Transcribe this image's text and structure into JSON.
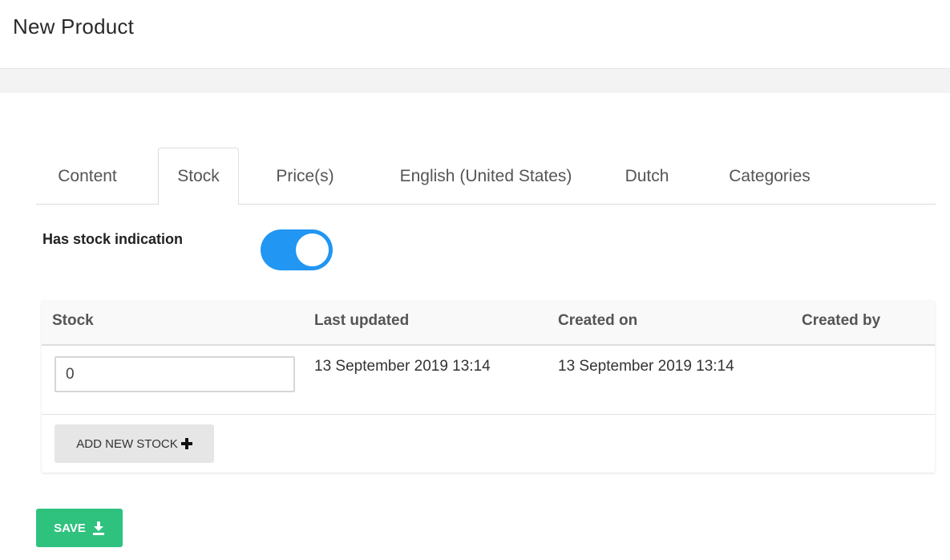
{
  "header": {
    "title": "New Product"
  },
  "tabs": [
    {
      "label": "Content",
      "active": false
    },
    {
      "label": "Stock",
      "active": true
    },
    {
      "label": "Price(s)",
      "active": false
    },
    {
      "label": "English (United States)",
      "active": false
    },
    {
      "label": "Dutch",
      "active": false
    },
    {
      "label": "Categories",
      "active": false
    }
  ],
  "stock_indication": {
    "label": "Has stock indication",
    "enabled": true,
    "toggle_color": "#2196f3"
  },
  "stock_table": {
    "columns": [
      "Stock",
      "Last updated",
      "Created on",
      "Created by"
    ],
    "rows": [
      {
        "stock": "0",
        "last_updated": "13 September 2019 13:14",
        "created_on": "13 September 2019 13:14",
        "created_by": ""
      }
    ],
    "add_button": {
      "label": "ADD NEW STOCK",
      "icon": "plus-icon"
    }
  },
  "save_button": {
    "label": "SAVE",
    "icon": "download-icon",
    "color": "#2ec27e"
  }
}
